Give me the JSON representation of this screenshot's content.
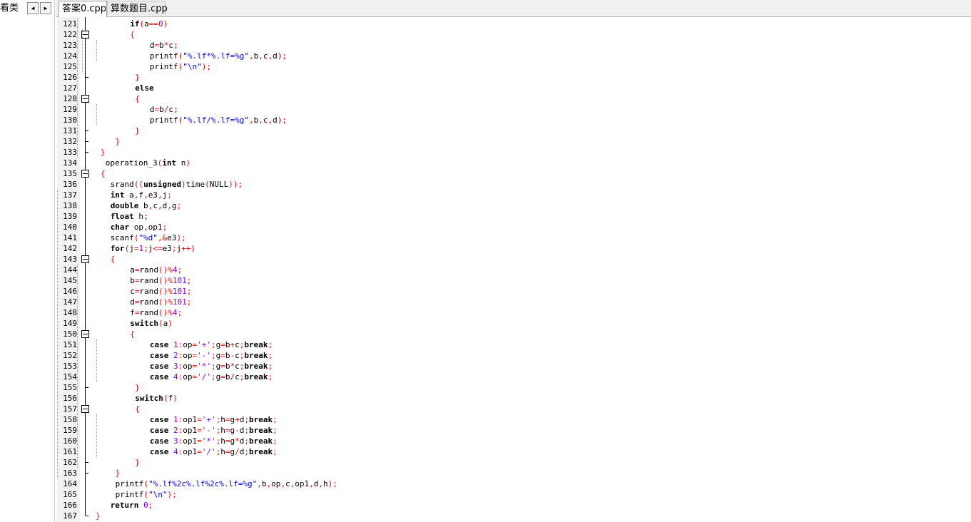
{
  "left_panel": {
    "tab_label": "看类",
    "prev_icon": "◀",
    "next_icon": "▶"
  },
  "tabs": [
    {
      "label": "答案0.cpp",
      "active": true
    },
    {
      "label": "算数题目.cpp",
      "active": false
    }
  ],
  "colors": {
    "keyword": "#000000",
    "operator": "#ff0000",
    "number": "#8000ff",
    "string": "#0000ff",
    "gutter": "#f2f2f2"
  },
  "code_lines": [
    {
      "n": "121",
      "indent": 7,
      "tokens": [
        [
          "kw",
          "if"
        ],
        [
          "op",
          "("
        ],
        [
          "t",
          "a"
        ],
        [
          "op",
          "=="
        ],
        [
          "num",
          "0"
        ],
        [
          "op",
          ")"
        ]
      ]
    },
    {
      "n": "122",
      "indent": 7,
      "tokens": [
        [
          "op",
          "{"
        ]
      ]
    },
    {
      "n": "123",
      "indent": 11,
      "tokens": [
        [
          "t",
          "d"
        ],
        [
          "op",
          "="
        ],
        [
          "t",
          "b"
        ],
        [
          "op",
          "*"
        ],
        [
          "t",
          "c"
        ],
        [
          "op",
          ";"
        ]
      ]
    },
    {
      "n": "124",
      "indent": 11,
      "tokens": [
        [
          "t",
          "printf"
        ],
        [
          "op",
          "("
        ],
        [
          "str",
          "\"%.lf*%.lf=%g\""
        ],
        [
          "op",
          ","
        ],
        [
          "t",
          "b"
        ],
        [
          "op",
          ","
        ],
        [
          "t",
          "c"
        ],
        [
          "op",
          ","
        ],
        [
          "t",
          "d"
        ],
        [
          "op",
          ");"
        ]
      ]
    },
    {
      "n": "125",
      "indent": 11,
      "tokens": [
        [
          "t",
          "printf"
        ],
        [
          "op",
          "("
        ],
        [
          "str",
          "\"\\n\""
        ],
        [
          "op",
          ");"
        ]
      ]
    },
    {
      "n": "126",
      "indent": 8,
      "tokens": [
        [
          "op",
          "}"
        ]
      ]
    },
    {
      "n": "127",
      "indent": 8,
      "tokens": [
        [
          "kw",
          "else"
        ]
      ]
    },
    {
      "n": "128",
      "indent": 8,
      "tokens": [
        [
          "op",
          "{"
        ]
      ]
    },
    {
      "n": "129",
      "indent": 11,
      "tokens": [
        [
          "t",
          "d"
        ],
        [
          "op",
          "="
        ],
        [
          "t",
          "b"
        ],
        [
          "op",
          "/"
        ],
        [
          "t",
          "c"
        ],
        [
          "op",
          ";"
        ]
      ]
    },
    {
      "n": "130",
      "indent": 11,
      "tokens": [
        [
          "t",
          "printf"
        ],
        [
          "op",
          "("
        ],
        [
          "str",
          "\"%.lf/%.lf=%g\""
        ],
        [
          "op",
          ","
        ],
        [
          "t",
          "b"
        ],
        [
          "op",
          ","
        ],
        [
          "t",
          "c"
        ],
        [
          "op",
          ","
        ],
        [
          "t",
          "d"
        ],
        [
          "op",
          ");"
        ]
      ]
    },
    {
      "n": "131",
      "indent": 8,
      "tokens": [
        [
          "op",
          "}"
        ]
      ]
    },
    {
      "n": "132",
      "indent": 4,
      "tokens": [
        [
          "op",
          "}"
        ]
      ]
    },
    {
      "n": "133",
      "indent": 1,
      "tokens": [
        [
          "op",
          "}"
        ]
      ]
    },
    {
      "n": "134",
      "indent": 2,
      "tokens": [
        [
          "t",
          "operation_3"
        ],
        [
          "op",
          "("
        ],
        [
          "kw",
          "int"
        ],
        [
          "t",
          " n"
        ],
        [
          "op",
          ")"
        ]
      ]
    },
    {
      "n": "135",
      "indent": 1,
      "tokens": [
        [
          "op",
          "{"
        ]
      ]
    },
    {
      "n": "136",
      "indent": 3,
      "tokens": [
        [
          "t",
          "srand"
        ],
        [
          "op",
          "(("
        ],
        [
          "kw",
          "unsigned"
        ],
        [
          "op",
          ")"
        ],
        [
          "t",
          "time"
        ],
        [
          "op",
          "("
        ],
        [
          "t",
          "NULL"
        ],
        [
          "op",
          "));"
        ]
      ]
    },
    {
      "n": "137",
      "indent": 3,
      "tokens": [
        [
          "kw",
          "int"
        ],
        [
          "t",
          " a"
        ],
        [
          "op",
          ","
        ],
        [
          "t",
          "f"
        ],
        [
          "op",
          ","
        ],
        [
          "t",
          "e3"
        ],
        [
          "op",
          ","
        ],
        [
          "t",
          "j"
        ],
        [
          "op",
          ";"
        ]
      ]
    },
    {
      "n": "138",
      "indent": 3,
      "tokens": [
        [
          "kw",
          "double"
        ],
        [
          "t",
          " b"
        ],
        [
          "op",
          ","
        ],
        [
          "t",
          "c"
        ],
        [
          "op",
          ","
        ],
        [
          "t",
          "d"
        ],
        [
          "op",
          ","
        ],
        [
          "t",
          "g"
        ],
        [
          "op",
          ";"
        ]
      ]
    },
    {
      "n": "139",
      "indent": 3,
      "tokens": [
        [
          "kw",
          "float"
        ],
        [
          "t",
          " h"
        ],
        [
          "op",
          ";"
        ]
      ]
    },
    {
      "n": "140",
      "indent": 3,
      "tokens": [
        [
          "kw",
          "char"
        ],
        [
          "t",
          " op"
        ],
        [
          "op",
          ","
        ],
        [
          "t",
          "op1"
        ],
        [
          "op",
          ";"
        ]
      ]
    },
    {
      "n": "141",
      "indent": 3,
      "tokens": [
        [
          "t",
          "scanf"
        ],
        [
          "op",
          "("
        ],
        [
          "str",
          "\"%d\""
        ],
        [
          "op",
          ",&"
        ],
        [
          "t",
          "e3"
        ],
        [
          "op",
          ");"
        ]
      ]
    },
    {
      "n": "142",
      "indent": 3,
      "tokens": [
        [
          "kw",
          "for"
        ],
        [
          "op",
          "("
        ],
        [
          "t",
          "j"
        ],
        [
          "op",
          "="
        ],
        [
          "num",
          "1"
        ],
        [
          "op",
          ";"
        ],
        [
          "t",
          "j"
        ],
        [
          "op",
          "<="
        ],
        [
          "t",
          "e3"
        ],
        [
          "op",
          ";"
        ],
        [
          "t",
          "j"
        ],
        [
          "op",
          "++)"
        ]
      ]
    },
    {
      "n": "143",
      "indent": 3,
      "tokens": [
        [
          "op",
          "{"
        ]
      ]
    },
    {
      "n": "144",
      "indent": 7,
      "tokens": [
        [
          "t",
          "a"
        ],
        [
          "op",
          "="
        ],
        [
          "t",
          "rand"
        ],
        [
          "op",
          "()%"
        ],
        [
          "num",
          "4"
        ],
        [
          "op",
          ";"
        ]
      ]
    },
    {
      "n": "145",
      "indent": 7,
      "tokens": [
        [
          "t",
          "b"
        ],
        [
          "op",
          "="
        ],
        [
          "t",
          "rand"
        ],
        [
          "op",
          "()%"
        ],
        [
          "num",
          "101"
        ],
        [
          "op",
          ";"
        ]
      ]
    },
    {
      "n": "146",
      "indent": 7,
      "tokens": [
        [
          "t",
          "c"
        ],
        [
          "op",
          "="
        ],
        [
          "t",
          "rand"
        ],
        [
          "op",
          "()%"
        ],
        [
          "num",
          "101"
        ],
        [
          "op",
          ";"
        ]
      ]
    },
    {
      "n": "147",
      "indent": 7,
      "tokens": [
        [
          "t",
          "d"
        ],
        [
          "op",
          "="
        ],
        [
          "t",
          "rand"
        ],
        [
          "op",
          "()%"
        ],
        [
          "num",
          "101"
        ],
        [
          "op",
          ";"
        ]
      ]
    },
    {
      "n": "148",
      "indent": 7,
      "tokens": [
        [
          "t",
          "f"
        ],
        [
          "op",
          "="
        ],
        [
          "t",
          "rand"
        ],
        [
          "op",
          "()%"
        ],
        [
          "num",
          "4"
        ],
        [
          "op",
          ";"
        ]
      ]
    },
    {
      "n": "149",
      "indent": 7,
      "tokens": [
        [
          "kw",
          "switch"
        ],
        [
          "op",
          "("
        ],
        [
          "t",
          "a"
        ],
        [
          "op",
          ")"
        ]
      ]
    },
    {
      "n": "150",
      "indent": 7,
      "tokens": [
        [
          "op",
          "{"
        ]
      ]
    },
    {
      "n": "151",
      "indent": 11,
      "tokens": [
        [
          "kw",
          "case"
        ],
        [
          "t",
          " "
        ],
        [
          "num",
          "1"
        ],
        [
          "op",
          ":"
        ],
        [
          "t",
          "op"
        ],
        [
          "op",
          "="
        ],
        [
          "num",
          "'+'"
        ],
        [
          "op",
          ";"
        ],
        [
          "t",
          "g"
        ],
        [
          "op",
          "="
        ],
        [
          "t",
          "b"
        ],
        [
          "op",
          "+"
        ],
        [
          "t",
          "c"
        ],
        [
          "op",
          ";"
        ],
        [
          "kw",
          "break"
        ],
        [
          "op",
          ";"
        ]
      ]
    },
    {
      "n": "152",
      "indent": 11,
      "tokens": [
        [
          "kw",
          "case"
        ],
        [
          "t",
          " "
        ],
        [
          "num",
          "2"
        ],
        [
          "op",
          ":"
        ],
        [
          "t",
          "op"
        ],
        [
          "op",
          "="
        ],
        [
          "num",
          "'-'"
        ],
        [
          "op",
          ";"
        ],
        [
          "t",
          "g"
        ],
        [
          "op",
          "="
        ],
        [
          "t",
          "b"
        ],
        [
          "op",
          "-"
        ],
        [
          "t",
          "c"
        ],
        [
          "op",
          ";"
        ],
        [
          "kw",
          "break"
        ],
        [
          "op",
          ";"
        ]
      ]
    },
    {
      "n": "153",
      "indent": 11,
      "tokens": [
        [
          "kw",
          "case"
        ],
        [
          "t",
          " "
        ],
        [
          "num",
          "3"
        ],
        [
          "op",
          ":"
        ],
        [
          "t",
          "op"
        ],
        [
          "op",
          "="
        ],
        [
          "num",
          "'*'"
        ],
        [
          "op",
          ";"
        ],
        [
          "t",
          "g"
        ],
        [
          "op",
          "="
        ],
        [
          "t",
          "b"
        ],
        [
          "op",
          "*"
        ],
        [
          "t",
          "c"
        ],
        [
          "op",
          ";"
        ],
        [
          "kw",
          "break"
        ],
        [
          "op",
          ";"
        ]
      ]
    },
    {
      "n": "154",
      "indent": 11,
      "tokens": [
        [
          "kw",
          "case"
        ],
        [
          "t",
          " "
        ],
        [
          "num",
          "4"
        ],
        [
          "op",
          ":"
        ],
        [
          "t",
          "op"
        ],
        [
          "op",
          "="
        ],
        [
          "num",
          "'/'"
        ],
        [
          "op",
          ";"
        ],
        [
          "t",
          "g"
        ],
        [
          "op",
          "="
        ],
        [
          "t",
          "b"
        ],
        [
          "op",
          "/"
        ],
        [
          "t",
          "c"
        ],
        [
          "op",
          ";"
        ],
        [
          "kw",
          "break"
        ],
        [
          "op",
          ";"
        ]
      ]
    },
    {
      "n": "155",
      "indent": 8,
      "tokens": [
        [
          "op",
          "}"
        ]
      ]
    },
    {
      "n": "156",
      "indent": 8,
      "tokens": [
        [
          "kw",
          "switch"
        ],
        [
          "op",
          "("
        ],
        [
          "t",
          "f"
        ],
        [
          "op",
          ")"
        ]
      ]
    },
    {
      "n": "157",
      "indent": 8,
      "tokens": [
        [
          "op",
          "{"
        ]
      ]
    },
    {
      "n": "158",
      "indent": 11,
      "tokens": [
        [
          "kw",
          "case"
        ],
        [
          "t",
          " "
        ],
        [
          "num",
          "1"
        ],
        [
          "op",
          ":"
        ],
        [
          "t",
          "op1"
        ],
        [
          "op",
          "="
        ],
        [
          "num",
          "'+'"
        ],
        [
          "op",
          ";"
        ],
        [
          "t",
          "h"
        ],
        [
          "op",
          "="
        ],
        [
          "t",
          "g"
        ],
        [
          "op",
          "+"
        ],
        [
          "t",
          "d"
        ],
        [
          "op",
          ";"
        ],
        [
          "kw",
          "break"
        ],
        [
          "op",
          ";"
        ]
      ]
    },
    {
      "n": "159",
      "indent": 11,
      "tokens": [
        [
          "kw",
          "case"
        ],
        [
          "t",
          " "
        ],
        [
          "num",
          "2"
        ],
        [
          "op",
          ":"
        ],
        [
          "t",
          "op1"
        ],
        [
          "op",
          "="
        ],
        [
          "num",
          "'-'"
        ],
        [
          "op",
          ";"
        ],
        [
          "t",
          "h"
        ],
        [
          "op",
          "="
        ],
        [
          "t",
          "g"
        ],
        [
          "op",
          "-"
        ],
        [
          "t",
          "d"
        ],
        [
          "op",
          ";"
        ],
        [
          "kw",
          "break"
        ],
        [
          "op",
          ";"
        ]
      ]
    },
    {
      "n": "160",
      "indent": 11,
      "tokens": [
        [
          "kw",
          "case"
        ],
        [
          "t",
          " "
        ],
        [
          "num",
          "3"
        ],
        [
          "op",
          ":"
        ],
        [
          "t",
          "op1"
        ],
        [
          "op",
          "="
        ],
        [
          "num",
          "'*'"
        ],
        [
          "op",
          ";"
        ],
        [
          "t",
          "h"
        ],
        [
          "op",
          "="
        ],
        [
          "t",
          "g"
        ],
        [
          "op",
          "*"
        ],
        [
          "t",
          "d"
        ],
        [
          "op",
          ";"
        ],
        [
          "kw",
          "break"
        ],
        [
          "op",
          ";"
        ]
      ]
    },
    {
      "n": "161",
      "indent": 11,
      "tokens": [
        [
          "kw",
          "case"
        ],
        [
          "t",
          " "
        ],
        [
          "num",
          "4"
        ],
        [
          "op",
          ":"
        ],
        [
          "t",
          "op1"
        ],
        [
          "op",
          "="
        ],
        [
          "num",
          "'/'"
        ],
        [
          "op",
          ";"
        ],
        [
          "t",
          "h"
        ],
        [
          "op",
          "="
        ],
        [
          "t",
          "g"
        ],
        [
          "op",
          "/"
        ],
        [
          "t",
          "d"
        ],
        [
          "op",
          ";"
        ],
        [
          "kw",
          "break"
        ],
        [
          "op",
          ";"
        ]
      ]
    },
    {
      "n": "162",
      "indent": 8,
      "tokens": [
        [
          "op",
          "}"
        ]
      ]
    },
    {
      "n": "163",
      "indent": 4,
      "tokens": [
        [
          "op",
          "}"
        ]
      ]
    },
    {
      "n": "164",
      "indent": 4,
      "tokens": [
        [
          "t",
          "printf"
        ],
        [
          "op",
          "("
        ],
        [
          "str",
          "\"%.lf%2c%.lf%2c%.lf=%g\""
        ],
        [
          "op",
          ","
        ],
        [
          "t",
          "b"
        ],
        [
          "op",
          ","
        ],
        [
          "t",
          "op"
        ],
        [
          "op",
          ","
        ],
        [
          "t",
          "c"
        ],
        [
          "op",
          ","
        ],
        [
          "t",
          "op1"
        ],
        [
          "op",
          ","
        ],
        [
          "t",
          "d"
        ],
        [
          "op",
          ","
        ],
        [
          "t",
          "h"
        ],
        [
          "op",
          ");"
        ]
      ]
    },
    {
      "n": "165",
      "indent": 4,
      "tokens": [
        [
          "t",
          "printf"
        ],
        [
          "op",
          "("
        ],
        [
          "str",
          "\"\\n\""
        ],
        [
          "op",
          ");"
        ]
      ]
    },
    {
      "n": "166",
      "indent": 3,
      "tokens": [
        [
          "kw",
          "return"
        ],
        [
          "t",
          " "
        ],
        [
          "num",
          "0"
        ],
        [
          "op",
          ";"
        ]
      ]
    },
    {
      "n": "167",
      "indent": 0,
      "tokens": [
        [
          "op",
          "}"
        ]
      ]
    }
  ]
}
